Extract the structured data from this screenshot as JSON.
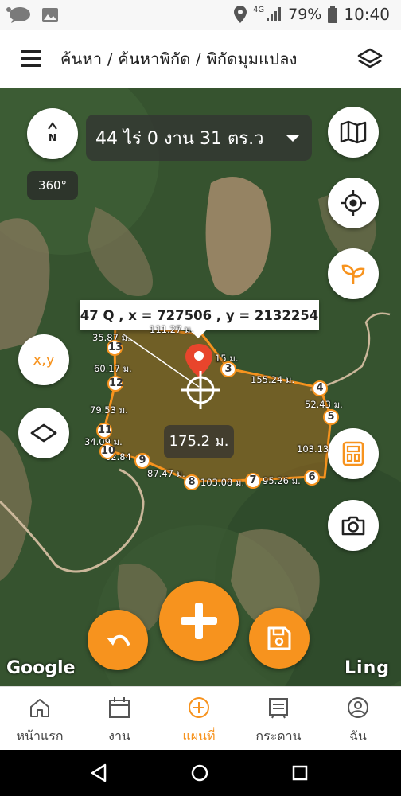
{
  "status_bar": {
    "battery": "79%",
    "time": "10:40",
    "network": "4G"
  },
  "header": {
    "breadcrumb": "ค้นหา / ค้นหาพิกัด / พิกัดมุมแปลง",
    "menu_icon": "hamburger-icon",
    "layers_icon": "layers-icon"
  },
  "map": {
    "compass_label": "N",
    "heading": "360°",
    "area": "44 ไร่ 0 งาน 31 ตร.ว",
    "coordinate_banner": "47 Q , x = 727506 , y = 2132254",
    "xy_button": "x,y",
    "center_distance": "175.2 ม.",
    "google_label": "Google",
    "brand_label": "Ling",
    "vertices": [
      "3",
      "4",
      "5",
      "6",
      "7",
      "8",
      "9",
      "10",
      "11",
      "12",
      "13"
    ],
    "distances": {
      "d3_4": "155.24 ม.",
      "d4_5": "52.43 ม.",
      "d5_6": "103.13",
      "d6_7": "95.26 ม.",
      "d7_8": "103.08 ม.",
      "d8_9": "87.47 ม.",
      "d9_10": "62.84",
      "d10_11": "34.09 ม.",
      "d11_12": "79.53 ม.",
      "d12_13": "60.17 ม.",
      "d13_14": "35.87 ม.",
      "d_top": "111.27 ม.",
      "d_2_3": "15 ม."
    }
  },
  "colors": {
    "accent": "#f7931e",
    "marker": "#e8452c"
  },
  "bottom_nav": {
    "items": [
      {
        "label": "หน้าแรก",
        "icon": "home-icon"
      },
      {
        "label": "งาน",
        "icon": "calendar-icon"
      },
      {
        "label": "แผนที่",
        "icon": "plus-circle-icon"
      },
      {
        "label": "กระดาน",
        "icon": "board-icon"
      },
      {
        "label": "ฉัน",
        "icon": "user-icon"
      }
    ],
    "active": "แผนที่"
  }
}
